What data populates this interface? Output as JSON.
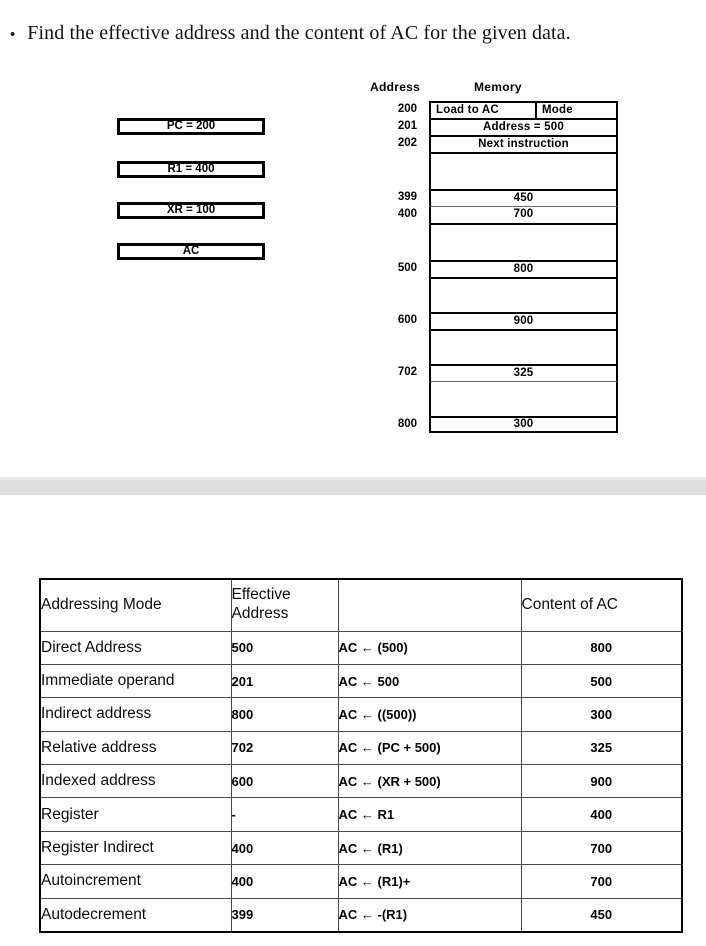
{
  "slide1": {
    "bullet_symbol": "•",
    "question": "Find the effective address and the content of  AC for the given data.",
    "registers": [
      {
        "name": "program-counter",
        "label": "PC = 200"
      },
      {
        "name": "register-r1",
        "label": "R1 = 400"
      },
      {
        "name": "index-register",
        "label": "XR = 100"
      },
      {
        "name": "accumulator",
        "label": "AC"
      }
    ],
    "memory": {
      "address_header": "Address",
      "memory_header": "Memory",
      "instruction_row": {
        "address": "200",
        "opcode": "Load to AC",
        "mode": "Mode"
      },
      "rows": [
        {
          "address": "201",
          "value": "Address = 500",
          "blank": false
        },
        {
          "address": "202",
          "value": "Next instruction",
          "blank": false
        },
        {
          "address": "",
          "value": "",
          "blank": true
        },
        {
          "address": "399",
          "value": "450",
          "blank": false
        },
        {
          "address": "400",
          "value": "700",
          "blank": false
        },
        {
          "address": "",
          "value": "",
          "blank": true
        },
        {
          "address": "500",
          "value": "800",
          "blank": false
        },
        {
          "address": "",
          "value": "",
          "blank": true
        },
        {
          "address": "600",
          "value": "900",
          "blank": false
        },
        {
          "address": "",
          "value": "",
          "blank": true
        },
        {
          "address": "702",
          "value": "325",
          "blank": false
        },
        {
          "address": "",
          "value": "",
          "blank": true
        },
        {
          "address": "800",
          "value": "300",
          "blank": false
        }
      ]
    }
  },
  "slide2": {
    "table": {
      "headers": [
        "Addressing Mode",
        "Effective Address",
        "",
        "Content of AC"
      ],
      "rows": [
        {
          "mode": "Direct Address",
          "ea": "500",
          "expr": "AC ← (500)",
          "ac": "800"
        },
        {
          "mode": "Immediate operand",
          "ea": "201",
          "expr": "AC ← 500",
          "ac": "500"
        },
        {
          "mode": "Indirect address",
          "ea": "800",
          "expr": "AC ← ((500))",
          "ac": "300"
        },
        {
          "mode": "Relative address",
          "ea": "702",
          "expr": "AC ← (PC + 500)",
          "ac": "325"
        },
        {
          "mode": "Indexed address",
          "ea": "600",
          "expr": "AC ← (XR + 500)",
          "ac": "900"
        },
        {
          "mode": "Register",
          "ea": "-",
          "expr": "AC ← R1",
          "ac": "400"
        },
        {
          "mode": "Register Indirect",
          "ea": "400",
          "expr": "AC ← (R1)",
          "ac": "700"
        },
        {
          "mode": "Autoincrement",
          "ea": "400",
          "expr": "AC ← (R1)+",
          "ac": "700"
        },
        {
          "mode": "Autodecrement",
          "ea": "399",
          "expr": "AC ← -(R1)",
          "ac": "450"
        }
      ]
    }
  },
  "colors": {
    "separator": "#dedede",
    "border": "#000000",
    "text": "#000000"
  }
}
